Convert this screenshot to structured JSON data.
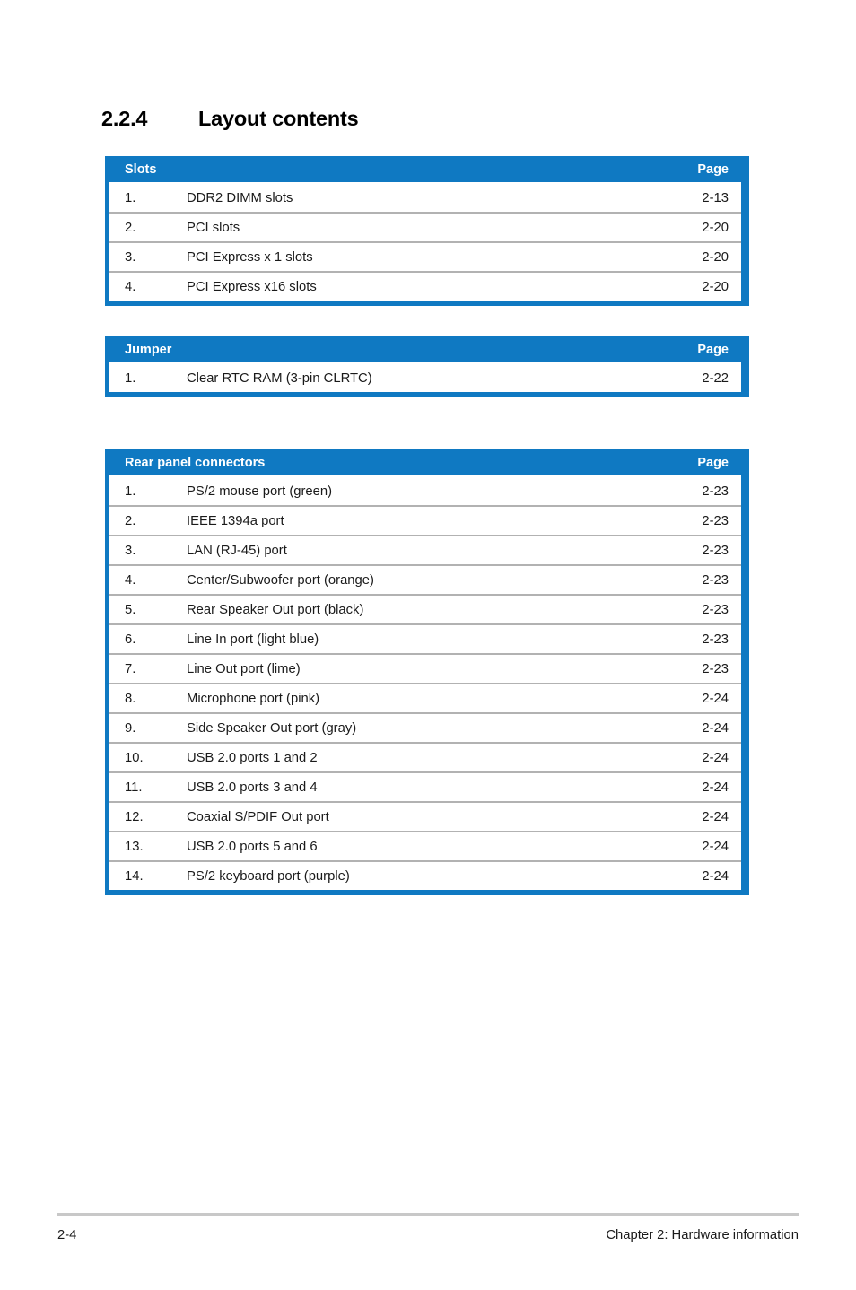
{
  "heading": {
    "number": "2.2.4",
    "title": "Layout contents"
  },
  "colors": {
    "accent_blue": "#0f79c2",
    "row_divider_gray": "#b2b2b2",
    "text_black": "#1a1a1a",
    "footer_rule_gray": "#c8c8c8"
  },
  "tables": [
    {
      "header_label": "Slots",
      "header_page": "Page",
      "rows": [
        {
          "num": "1.",
          "text": "DDR2 DIMM slots",
          "page": "2-13"
        },
        {
          "num": "2.",
          "text": "PCI slots",
          "page": "2-20"
        },
        {
          "num": "3.",
          "text": "PCI Express x 1 slots",
          "page": "2-20"
        },
        {
          "num": "4.",
          "text": "PCI Express x16 slots",
          "page": "2-20"
        }
      ]
    },
    {
      "header_label": "Jumper",
      "header_page": "Page",
      "rows": [
        {
          "num": "1.",
          "text": "Clear RTC RAM (3-pin CLRTC)",
          "page": "2-22"
        }
      ]
    },
    {
      "header_label": "Rear panel connectors",
      "header_page": "Page",
      "rows": [
        {
          "num": "1.",
          "text": "PS/2 mouse port (green)",
          "page": "2-23"
        },
        {
          "num": "2.",
          "text": "IEEE 1394a port",
          "page": "2-23"
        },
        {
          "num": "3.",
          "text": "LAN (RJ-45) port",
          "page": "2-23"
        },
        {
          "num": "4.",
          "text": "Center/Subwoofer port (orange)",
          "page": "2-23"
        },
        {
          "num": "5.",
          "text": "Rear Speaker Out port (black)",
          "page": "2-23"
        },
        {
          "num": "6.",
          "text": "Line In port (light blue)",
          "page": "2-23"
        },
        {
          "num": "7.",
          "text": "Line Out port (lime)",
          "page": "2-23"
        },
        {
          "num": "8.",
          "text": "Microphone port (pink)",
          "page": "2-24"
        },
        {
          "num": "9.",
          "text": "Side Speaker Out port (gray)",
          "page": "2-24"
        },
        {
          "num": "10.",
          "text": "USB 2.0 ports 1 and 2",
          "page": "2-24"
        },
        {
          "num": "11.",
          "text": "USB 2.0 ports 3 and 4",
          "page": "2-24"
        },
        {
          "num": "12.",
          "text": "Coaxial S/PDIF Out port",
          "page": "2-24"
        },
        {
          "num": "13.",
          "text": "USB 2.0 ports 5 and 6",
          "page": "2-24"
        },
        {
          "num": "14.",
          "text": "PS/2 keyboard port (purple)",
          "page": "2-24"
        }
      ]
    }
  ],
  "footer": {
    "page_number": "2-4",
    "chapter": "Chapter 2: Hardware information"
  }
}
